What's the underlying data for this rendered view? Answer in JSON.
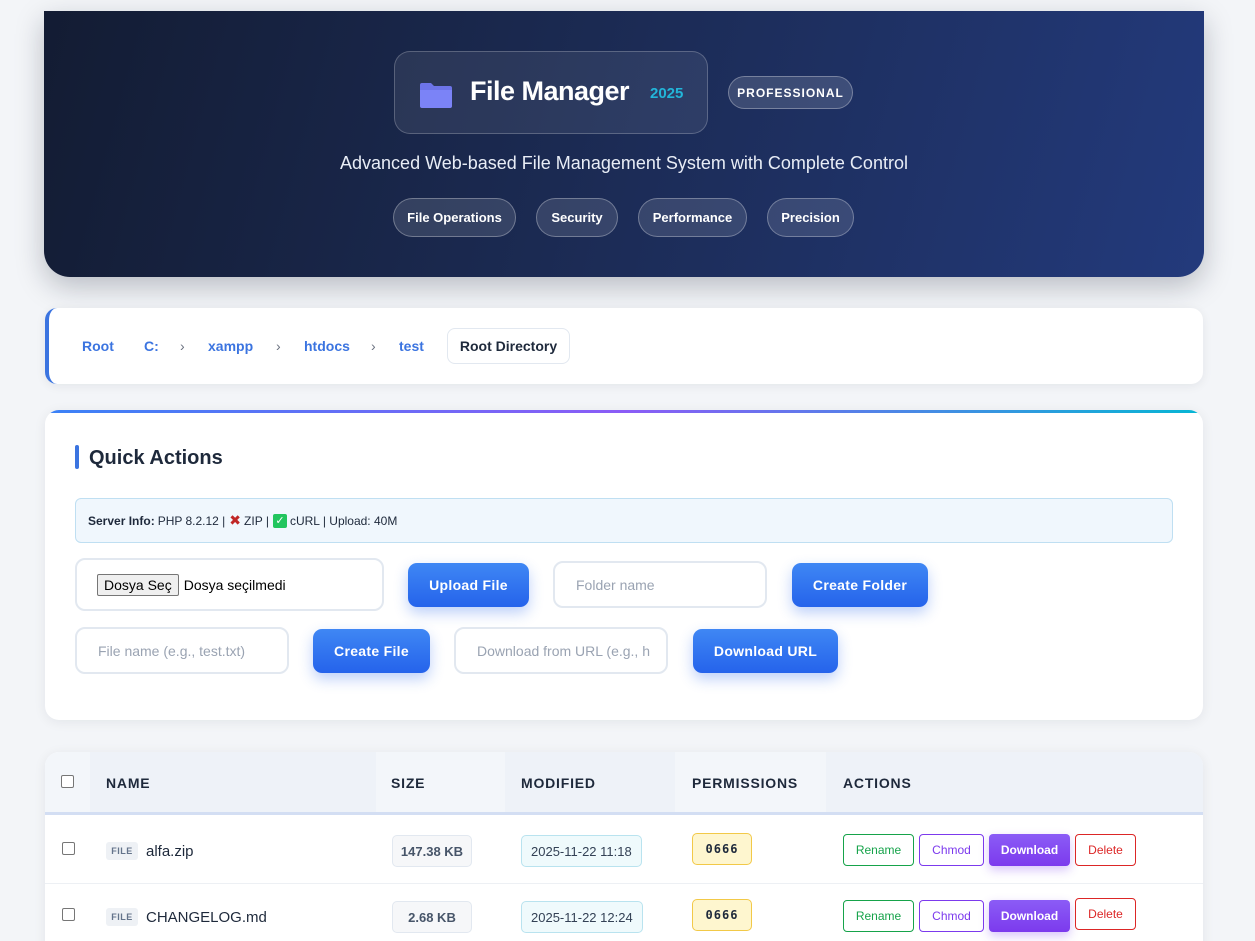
{
  "header": {
    "title": "File Manager",
    "year": "2025",
    "badge": "PROFESSIONAL",
    "subtitle": "Advanced Web-based File Management System with Complete Control",
    "features": [
      "File Operations",
      "Security",
      "Performance",
      "Precision"
    ],
    "folder_icon": "folder-icon"
  },
  "breadcrumb": {
    "items": [
      "Root",
      "C:",
      "xampp",
      "htdocs",
      "test"
    ],
    "separator": "›",
    "current": "Root Directory"
  },
  "quick_actions": {
    "title": "Quick Actions",
    "server_info": {
      "label": "Server Info:",
      "php": "PHP 8.2.12 |",
      "zip": "ZIP |",
      "curl": "cURL | Upload: 40M"
    },
    "file_picker": {
      "button": "Dosya Seç",
      "status": "Dosya seçilmedi"
    },
    "upload_button": "Upload File",
    "folder_placeholder": "Folder name",
    "create_folder_button": "Create Folder",
    "file_placeholder": "File name (e.g., test.txt)",
    "create_file_button": "Create File",
    "url_placeholder": "Download from URL (e.g., h",
    "download_url_button": "Download URL"
  },
  "table": {
    "columns": [
      "NAME",
      "SIZE",
      "MODIFIED",
      "PERMISSIONS",
      "ACTIONS"
    ],
    "actions": {
      "rename": "Rename",
      "chmod": "Chmod",
      "download": "Download",
      "delete": "Delete"
    },
    "rows": [
      {
        "type": "FILE",
        "name": "alfa.zip",
        "size": "147.38 KB",
        "modified": "2025-11-22 11:18",
        "permissions": "0666"
      },
      {
        "type": "FILE",
        "name": "CHANGELOG.md",
        "size": "2.68 KB",
        "modified": "2025-11-22 12:24",
        "permissions": "0666"
      }
    ]
  },
  "colors": {
    "accent": "#3b74e0",
    "header_bg": "#1b2a52",
    "year": "#22b5d9",
    "rename": "#16a34a",
    "chmod": "#7c3aed",
    "download": "#7c3aed",
    "delete": "#dc2626",
    "permissions_bg": "#fef6cf"
  }
}
